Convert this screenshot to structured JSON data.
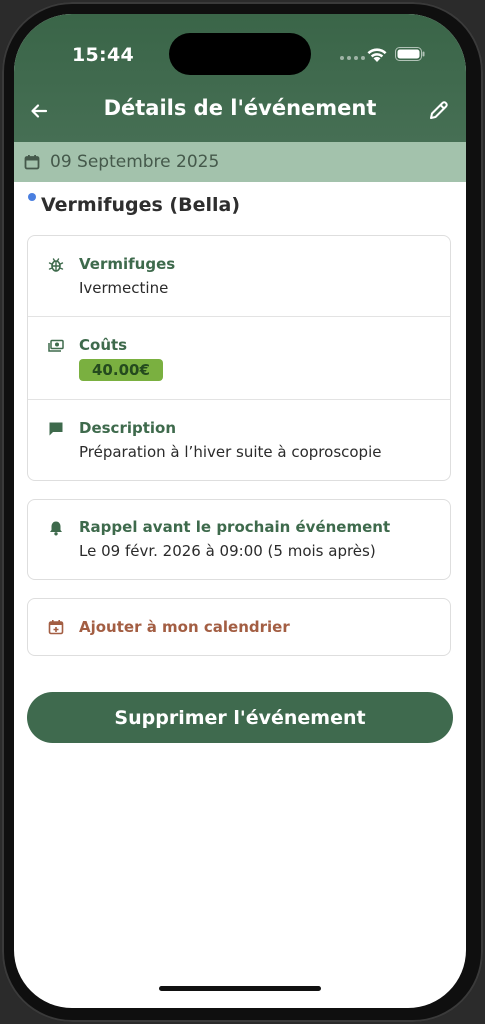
{
  "status_bar": {
    "time": "15:44"
  },
  "header": {
    "title": "Détails de l'événement",
    "back_icon": "arrow-left-icon",
    "edit_icon": "pencil-icon",
    "background": "#3a6548"
  },
  "date_bar": {
    "date": "09 Septembre 2025",
    "icon": "calendar-icon",
    "background": "#a3c2ac"
  },
  "event": {
    "title": "Vermifuges (Bella)",
    "dot_color": "#4a7fe0"
  },
  "details": {
    "treatment": {
      "icon": "bug-icon",
      "label": "Vermifuges",
      "value": "Ivermectine"
    },
    "cost": {
      "icon": "money-icon",
      "label": "Coûts",
      "value": "40.00€",
      "badge_color": "#7ab040"
    },
    "description": {
      "icon": "comment-icon",
      "label": "Description",
      "value": "Préparation à l’hiver suite à coproscopie"
    }
  },
  "reminder": {
    "icon": "bell-icon",
    "label": "Rappel avant le prochain événement",
    "value": "Le 09 févr. 2026 à 09:00 (5 mois après)"
  },
  "calendar_action": {
    "icon": "calendar-plus-icon",
    "label": "Ajouter à mon calendrier",
    "color": "#a35e43"
  },
  "delete_button": {
    "label": "Supprimer l'événement",
    "color": "#3f6a4e"
  }
}
